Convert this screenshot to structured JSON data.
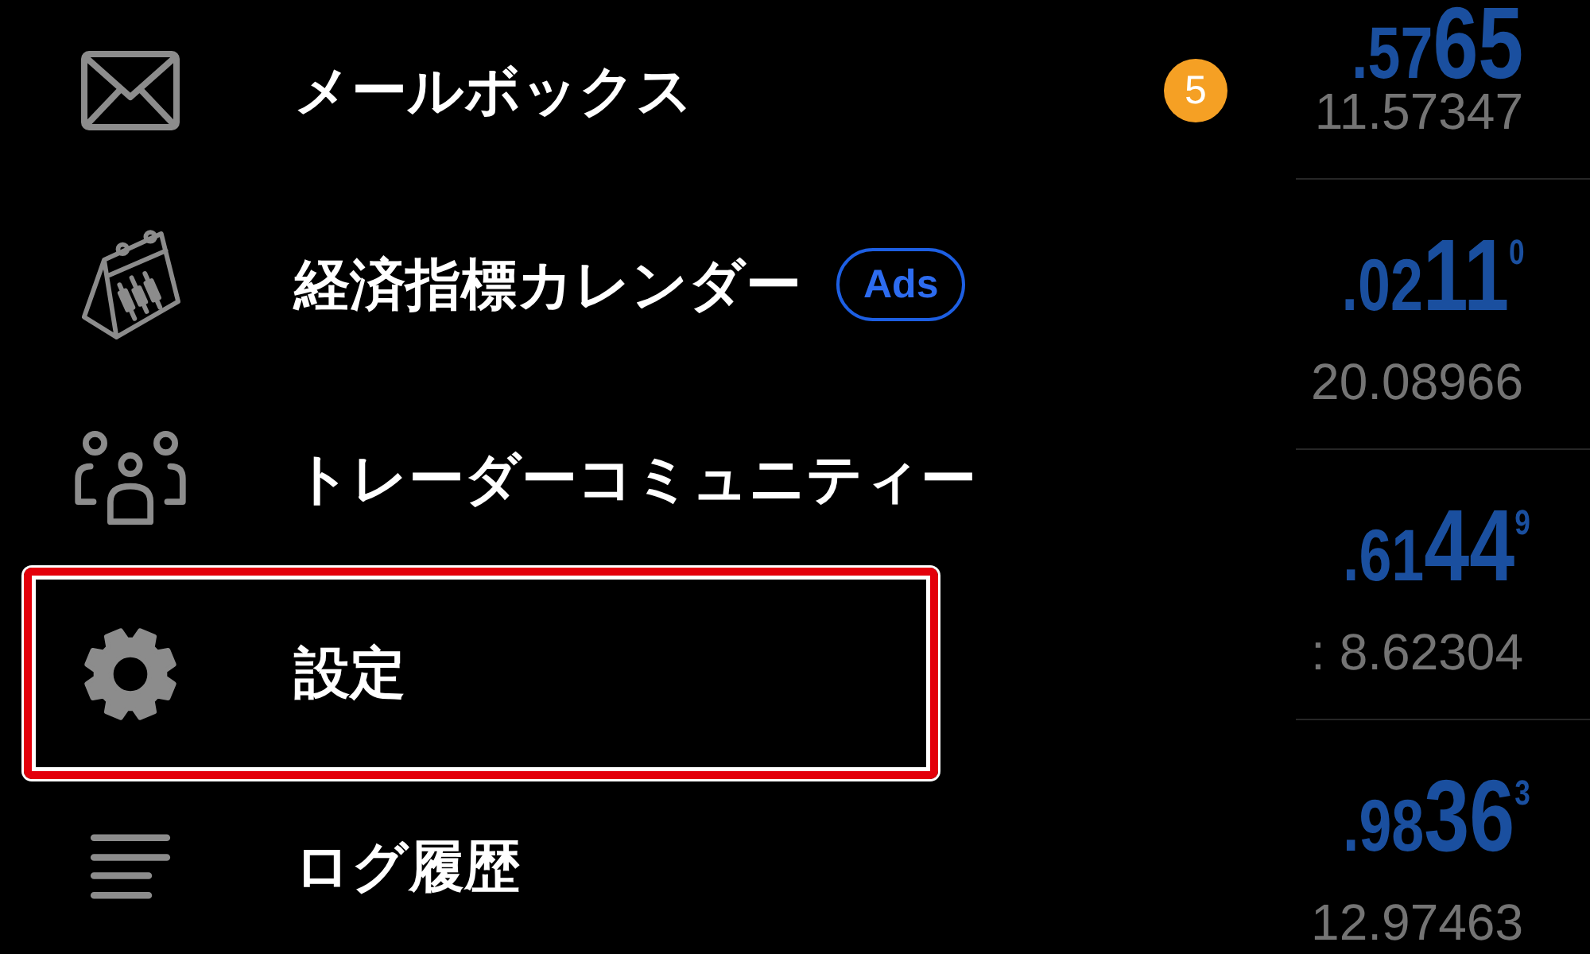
{
  "drawer": {
    "items": [
      {
        "kind": "mail",
        "label": "メールボックス",
        "badge": "5",
        "highlighted": false
      },
      {
        "kind": "calendar",
        "label": "経済指標カレンダー",
        "tag": "Ads",
        "highlighted": false
      },
      {
        "kind": "community",
        "label": "トレーダーコミュニティー",
        "highlighted": false
      },
      {
        "kind": "settings",
        "label": "設定",
        "highlighted": true
      },
      {
        "kind": "log",
        "label": "ログ履歴",
        "highlighted": false
      }
    ]
  },
  "quotes": {
    "rows": [
      {
        "price": {
          "lead": ".57",
          "pips": "65"
        },
        "reference": "11.57347"
      },
      {
        "price": {
          "lead": ".02",
          "pips": "11",
          "point": "0"
        },
        "reference": "20.08966"
      },
      {
        "price": {
          "lead": ".61",
          "pips": "44",
          "point": "9"
        },
        "reference": ": 8.62304"
      },
      {
        "price": {
          "lead": ".98",
          "pips": "36",
          "point": "3"
        },
        "reference": "12.97463"
      }
    ]
  }
}
